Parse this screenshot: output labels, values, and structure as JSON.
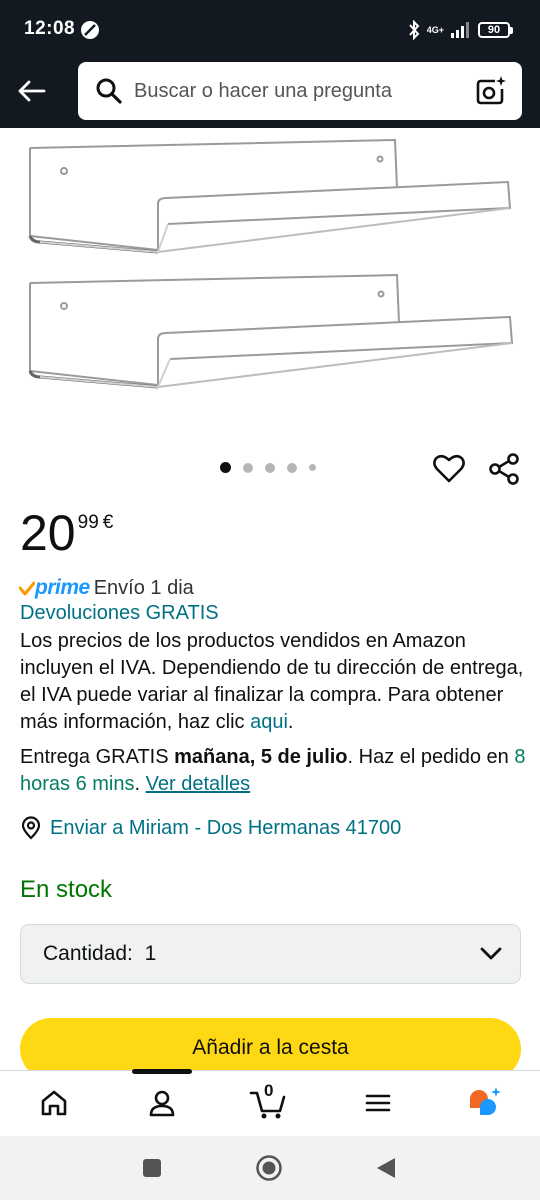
{
  "status_bar": {
    "time": "12:08",
    "network": "4G+",
    "battery": "90"
  },
  "search": {
    "placeholder": "Buscar o hacer una pregunta"
  },
  "carousel": {
    "count": 5,
    "active_index": 0
  },
  "price": {
    "whole": "20",
    "fraction": "99",
    "currency": "€"
  },
  "prime": {
    "brand": "prime",
    "shipping": "Envío 1 dia"
  },
  "returns": "Devoluciones GRATIS",
  "vat_notice": {
    "text": "Los precios de los productos vendidos en Amazon incluyen el IVA. Dependiendo de tu dirección de entrega, el IVA puede variar al finalizar la compra. Para obtener más información, haz clic ",
    "link": "aqui",
    "end": "."
  },
  "delivery": {
    "prefix": "Entrega GRATIS ",
    "date": "mañana, 5 de julio",
    "middle": ". Haz el pedido en ",
    "countdown": "8 horas 6 mins",
    "after": ". ",
    "details_link": "Ver detalles"
  },
  "ship_to": "Enviar a Miriam - Dos Hermanas 41700",
  "stock": "En stock",
  "quantity": {
    "label": "Cantidad:",
    "value": "1"
  },
  "add_to_cart": "Añadir a la cesta",
  "cart_count": "0",
  "colors": {
    "header_bg": "#131921",
    "link": "#007185",
    "in_stock": "#007600",
    "countdown": "#067d62",
    "prime_blue": "#1a98ff",
    "add_to_cart_bg": "#ffd814"
  }
}
